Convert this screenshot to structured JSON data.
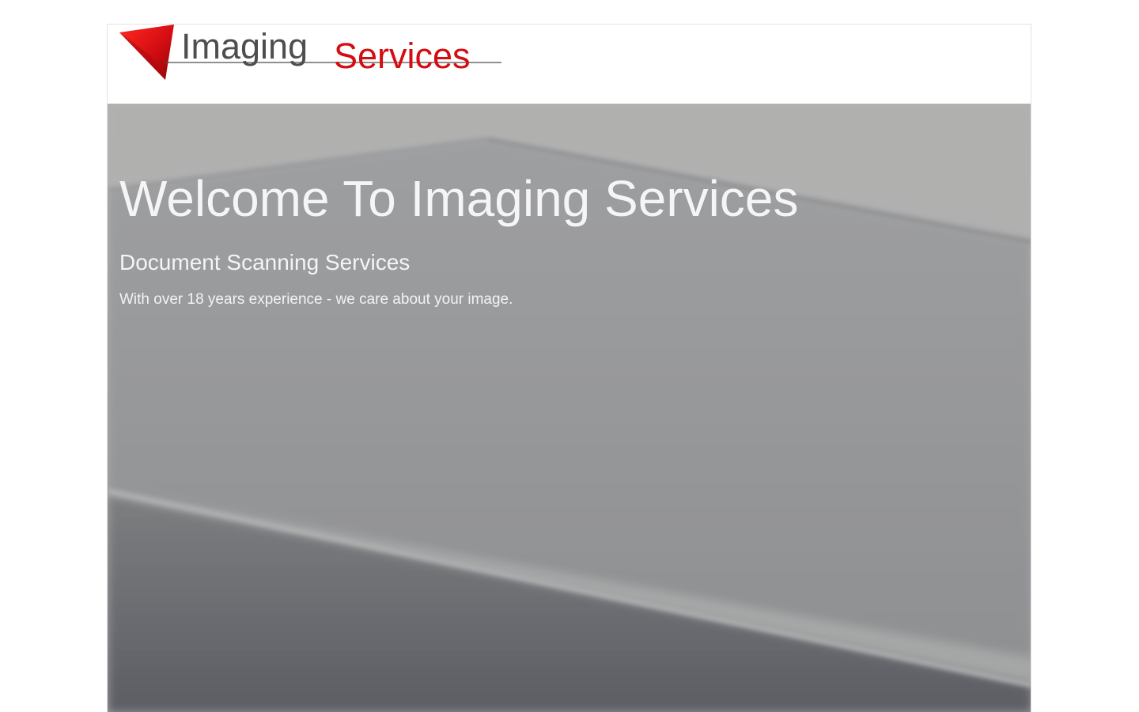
{
  "header": {
    "logo": {
      "primary_text": "Imaging",
      "secondary_text": "Services",
      "icon": "red-triangle-logo-mark",
      "colors": {
        "primary_text": "#4e4e4e",
        "secondary_text": "#d40d12",
        "mark": "#d40d12"
      }
    }
  },
  "hero": {
    "title": "Welcome To Imaging Services",
    "subtitle": "Document Scanning Services",
    "tagline": "With over 18 years experience - we care about your image.",
    "background_image": "grey-document-scanner-surface",
    "text_color": "#f5f5f5"
  }
}
